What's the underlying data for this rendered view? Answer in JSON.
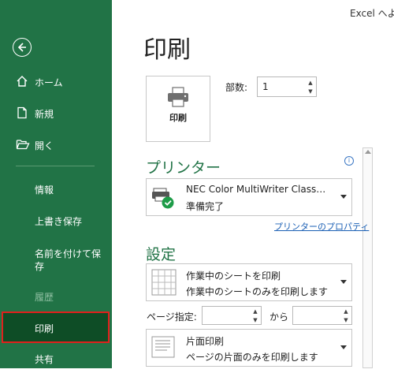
{
  "app": {
    "title": "Excel へよう"
  },
  "sidebar": {
    "back_icon": "back-arrow-icon",
    "items": [
      {
        "label": "ホーム",
        "icon": "home-icon"
      },
      {
        "label": "新規",
        "icon": "new-document-icon"
      },
      {
        "label": "開く",
        "icon": "open-folder-icon"
      },
      {
        "label": "情報"
      },
      {
        "label": "上書き保存"
      },
      {
        "label": "名前を付けて保存"
      },
      {
        "label": "履歴",
        "disabled": true
      },
      {
        "label": "印刷",
        "selected": true
      },
      {
        "label": "共有"
      }
    ],
    "colors": {
      "background": "#217346",
      "selected": "#0e4d26",
      "highlight_border": "#e0201c"
    }
  },
  "main": {
    "title": "印刷",
    "print_button": {
      "label": "印刷",
      "icon": "printer-icon"
    },
    "copies": {
      "label": "部数:",
      "value": "1"
    },
    "printer_section": {
      "heading": "プリンター",
      "info_icon": "info-icon",
      "selected_printer": {
        "name": "NEC Color MultiWriter Class…",
        "status": "準備完了",
        "icon": "printer-ready-icon"
      },
      "properties_link": "プリンターのプロパティ"
    },
    "settings_section": {
      "heading": "設定",
      "print_what": {
        "title": "作業中のシートを印刷",
        "description": "作業中のシートのみを印刷します",
        "icon": "sheet-grid-icon"
      },
      "pages": {
        "label": "ページ指定:",
        "from_value": "",
        "to_label": "から",
        "to_value": ""
      },
      "sides": {
        "title": "片面印刷",
        "description": "ページの片面のみを印刷します",
        "icon": "one-sided-icon"
      }
    },
    "accent_color": "#217346"
  }
}
